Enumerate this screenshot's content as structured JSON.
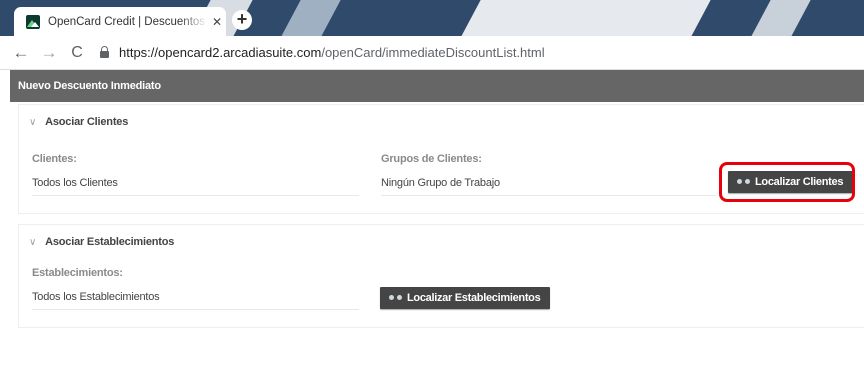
{
  "browser": {
    "tab_title": "OpenCard Credit | Descuentos Inmediatos",
    "close_glyph": "✕",
    "newtab_glyph": "+",
    "url_host": "https://opencard2.arcadiasuite.com",
    "url_path": "/openCard/immediateDiscountList.html",
    "icons": {
      "back": "←",
      "forward": "→",
      "reload": "C"
    }
  },
  "page": {
    "title": "Nuevo Descuento Inmediato",
    "sections": [
      {
        "title": "Asociar Clientes",
        "chevron": "∨",
        "fields": [
          {
            "label": "Clientes:",
            "value": "Todos los Clientes"
          },
          {
            "label": "Grupos de Clientes:",
            "value": "Ningún Grupo de Trabajo"
          }
        ],
        "button_label": "Localizar Clientes"
      },
      {
        "title": "Asociar Establecimientos",
        "chevron": "∨",
        "fields": [
          {
            "label": "Establecimientos:",
            "value": "Todos los Establecimientos"
          }
        ],
        "button_label": "Localizar Establecimientos"
      }
    ]
  },
  "colors": {
    "title_bar": "#666666",
    "button": "#454545",
    "highlight": "#e8000b"
  }
}
